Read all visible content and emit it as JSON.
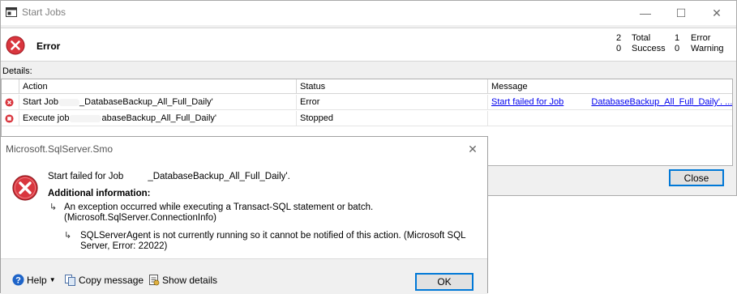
{
  "startjobs": {
    "title": "Start Jobs",
    "window_controls": {
      "minimize": "—",
      "maximize": "☐",
      "close": "✕"
    },
    "status_title": "Error",
    "stats": {
      "total_count": "2",
      "total_label": "Total",
      "success_count": "0",
      "success_label": "Success",
      "error_count": "1",
      "error_label": "Error",
      "warning_count": "0",
      "warning_label": "Warning"
    },
    "details_label": "Details:",
    "columns": {
      "action": "Action",
      "status": "Status",
      "message": "Message"
    },
    "rows": [
      {
        "icon": "error-icon",
        "action_prefix": "Start Job",
        "action_suffix": "_DatabaseBackup_All_Full_Daily'",
        "status": "Error",
        "message_1": "Start failed for Job",
        "message_2": "DatabaseBackup_All_Full_Daily'. ..."
      },
      {
        "icon": "stopped-icon",
        "action_prefix": "Execute job",
        "action_suffix": "abaseBackup_All_Full_Daily'",
        "status": "Stopped",
        "message_1": "",
        "message_2": ""
      }
    ],
    "close_label": "Close"
  },
  "smo": {
    "title": "Microsoft.SqlServer.Smo",
    "close_glyph": "✕",
    "line1_prefix": "Start failed for Job",
    "line1_suffix": "_DatabaseBackup_All_Full_Daily'.",
    "additional_info": "Additional information:",
    "exception_line1": "An exception occurred while executing a Transact-SQL statement or batch.",
    "exception_line2": "(Microsoft.SqlServer.ConnectionInfo)",
    "agent_line1": "SQLServerAgent is not currently running so it cannot be notified of this action. (Microsoft SQL",
    "agent_line2": "Server, Error: 22022)",
    "footer": {
      "help": "Help",
      "copy": "Copy message",
      "details": "Show details",
      "ok": "OK"
    }
  },
  "colors": {
    "error_red": "#d9363e",
    "accent_blue": "#0078d7",
    "link": "#0000ee"
  }
}
